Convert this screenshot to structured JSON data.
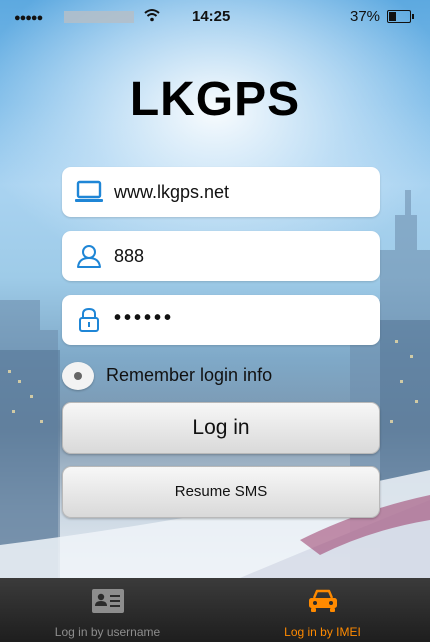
{
  "status_bar": {
    "time": "14:25",
    "battery": "37%",
    "battery_level": 0.37
  },
  "app": {
    "title": "LKGPS"
  },
  "form": {
    "server": {
      "value": "www.lkgps.net",
      "icon": "laptop-icon"
    },
    "username": {
      "value": "888",
      "icon": "user-icon"
    },
    "password": {
      "value": "••••••",
      "icon": "lock-icon"
    },
    "remember_label": "Remember login info",
    "login_label": "Log in",
    "sms_label": "Resume SMS"
  },
  "tabs": [
    {
      "label": "Log in by username",
      "icon": "id-card-icon",
      "active": false
    },
    {
      "label": "Log in by IMEI",
      "icon": "car-icon",
      "active": true
    }
  ],
  "colors": {
    "accent": "#ff8a00",
    "icon_blue": "#1f86d6",
    "tabbar": "#2b2b2b"
  }
}
